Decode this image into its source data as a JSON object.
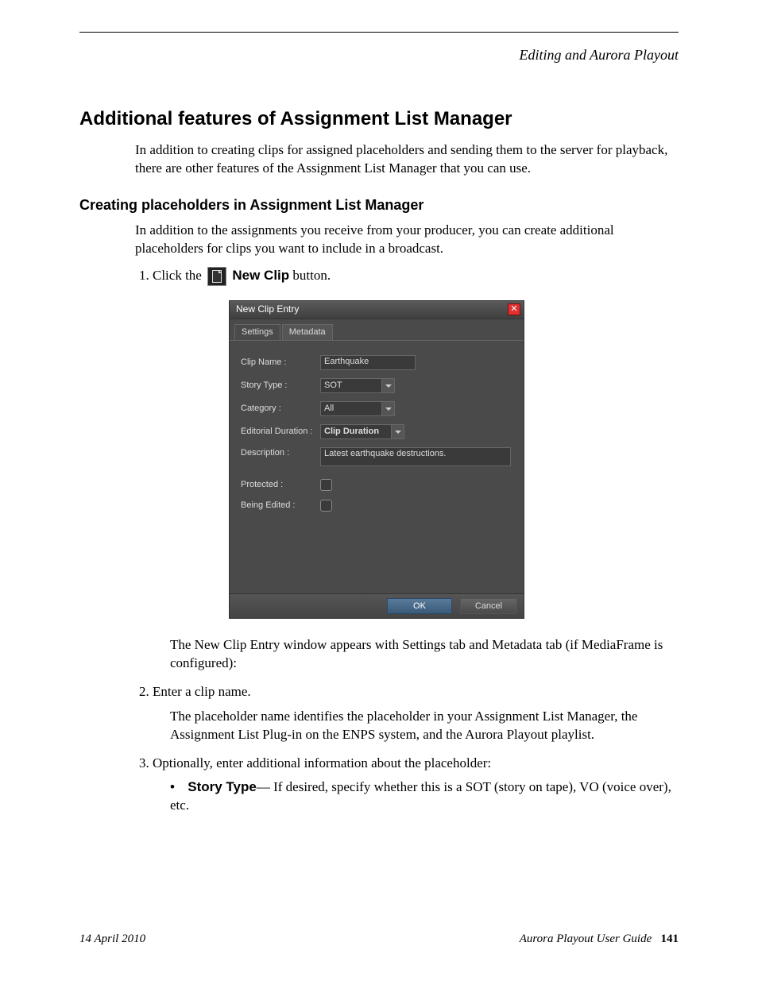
{
  "runningHead": "Editing and Aurora Playout",
  "h1": "Additional features of Assignment List Manager",
  "introPara": "In addition to creating clips for assigned placeholders and sending them to the server for playback, there are other features of the Assignment List Manager that you can use.",
  "h2": "Creating placeholders in Assignment List Manager",
  "subIntro": "In addition to the assignments you receive from your producer, you can create additional placeholders for clips you want to include in a broadcast.",
  "step1_pre": "Click the ",
  "step1_bold": "New Clip",
  "step1_post": " button.",
  "dialog": {
    "title": "New Clip Entry",
    "tabs": {
      "settings": "Settings",
      "metadata": "Metadata"
    },
    "labels": {
      "clipName": "Clip Name :",
      "storyType": "Story Type :",
      "category": "Category :",
      "editorialDuration": "Editorial Duration :",
      "description": "Description :",
      "protected": "Protected :",
      "beingEdited": "Being Edited :"
    },
    "values": {
      "clipName": "Earthquake",
      "storyType": "SOT",
      "category": "All",
      "editorialDuration": "Clip Duration",
      "description": "Latest earthquake destructions."
    },
    "buttons": {
      "ok": "OK",
      "cancel": "Cancel"
    }
  },
  "afterDialog": "The New Clip Entry window appears with Settings tab and Metadata tab (if MediaFrame is configured):",
  "step2": "Enter a clip name.",
  "step2_follow": "The placeholder name identifies the placeholder in your Assignment List Manager, the Assignment List Plug-in on the ENPS system, and the Aurora Playout playlist.",
  "step3": "Optionally, enter additional information about the placeholder:",
  "bullet_label": "Story Type",
  "bullet_rest": "— If desired, specify whether this is a SOT (story on tape), VO (voice over), etc.",
  "footer": {
    "date": "14  April  2010",
    "guide": "Aurora Playout User Guide",
    "page": "141"
  }
}
